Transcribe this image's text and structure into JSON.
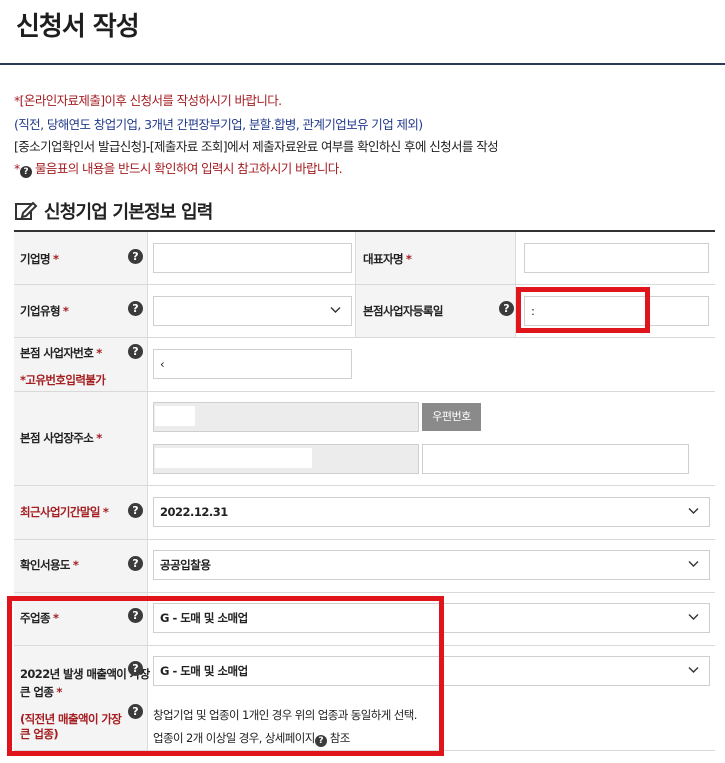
{
  "page": {
    "title": "신청서 작성"
  },
  "notices": {
    "n1": "*[온라인자료제출]이후 신청서를 작성하시기 바랍니다.",
    "n2": "(직전, 당해연도 창업기업, 3개년 간편장부기업, 분할.합병, 관계기업보유 기업 제외)",
    "n3": "[중소기업확인서 발급신청]-[제출자료 조회]에서 제출자료완료 여부를 확인하신 후에 신청서를 작성",
    "n4_prefix": "*",
    "n4_text": " 물음표의 내용을 반드시 확인하여 입력시 참고하시기 바랍니다."
  },
  "section": {
    "title": "신청기업 기본정보 입력"
  },
  "form": {
    "company_name_label": "기업명",
    "ceo_name_label": "대표자명",
    "company_type_label": "기업유형",
    "hq_reg_date_label": "본점사업자등록일",
    "hq_reg_date_value": ":",
    "hq_biz_no_label": "본점 사업자번호",
    "hq_biz_no_note": "*고유번호입력불가",
    "hq_biz_no_value": "‹",
    "hq_address_label": "본점 사업장주소",
    "zip_button": "우편번호",
    "recent_period_label": "최근사업기간말일",
    "recent_period_value": "2022.12.31",
    "purpose_label": "확인서용도",
    "purpose_value": "공공입찰용",
    "main_industry_label": "주업종",
    "main_industry_value": "G - 도매 및 소매업",
    "top_sales_label_1": "2022년 발생 매출액이 가장",
    "top_sales_label_2": "큰 업종",
    "top_sales_note_1": "(직전년 매출액이 가장",
    "top_sales_note_2": "큰 업종)",
    "top_sales_value": "G - 도매 및 소매업",
    "desc_1": "창업기업 및 업종이 1개인 경우 위의 업종과 동일하게 선택.",
    "desc_2_prefix": "업종이 2개 이상일 경우, 상세페이지",
    "desc_2_suffix": " 참조",
    "required_mark": "*",
    "help_glyph": "?"
  },
  "colors": {
    "accent_red": "#a41e22",
    "highlight_red": "#e0141b",
    "notice_blue": "#233b8c"
  },
  "icons": {
    "section": "edit-icon",
    "help": "question-circle-icon",
    "select": "chevron-down-icon"
  }
}
